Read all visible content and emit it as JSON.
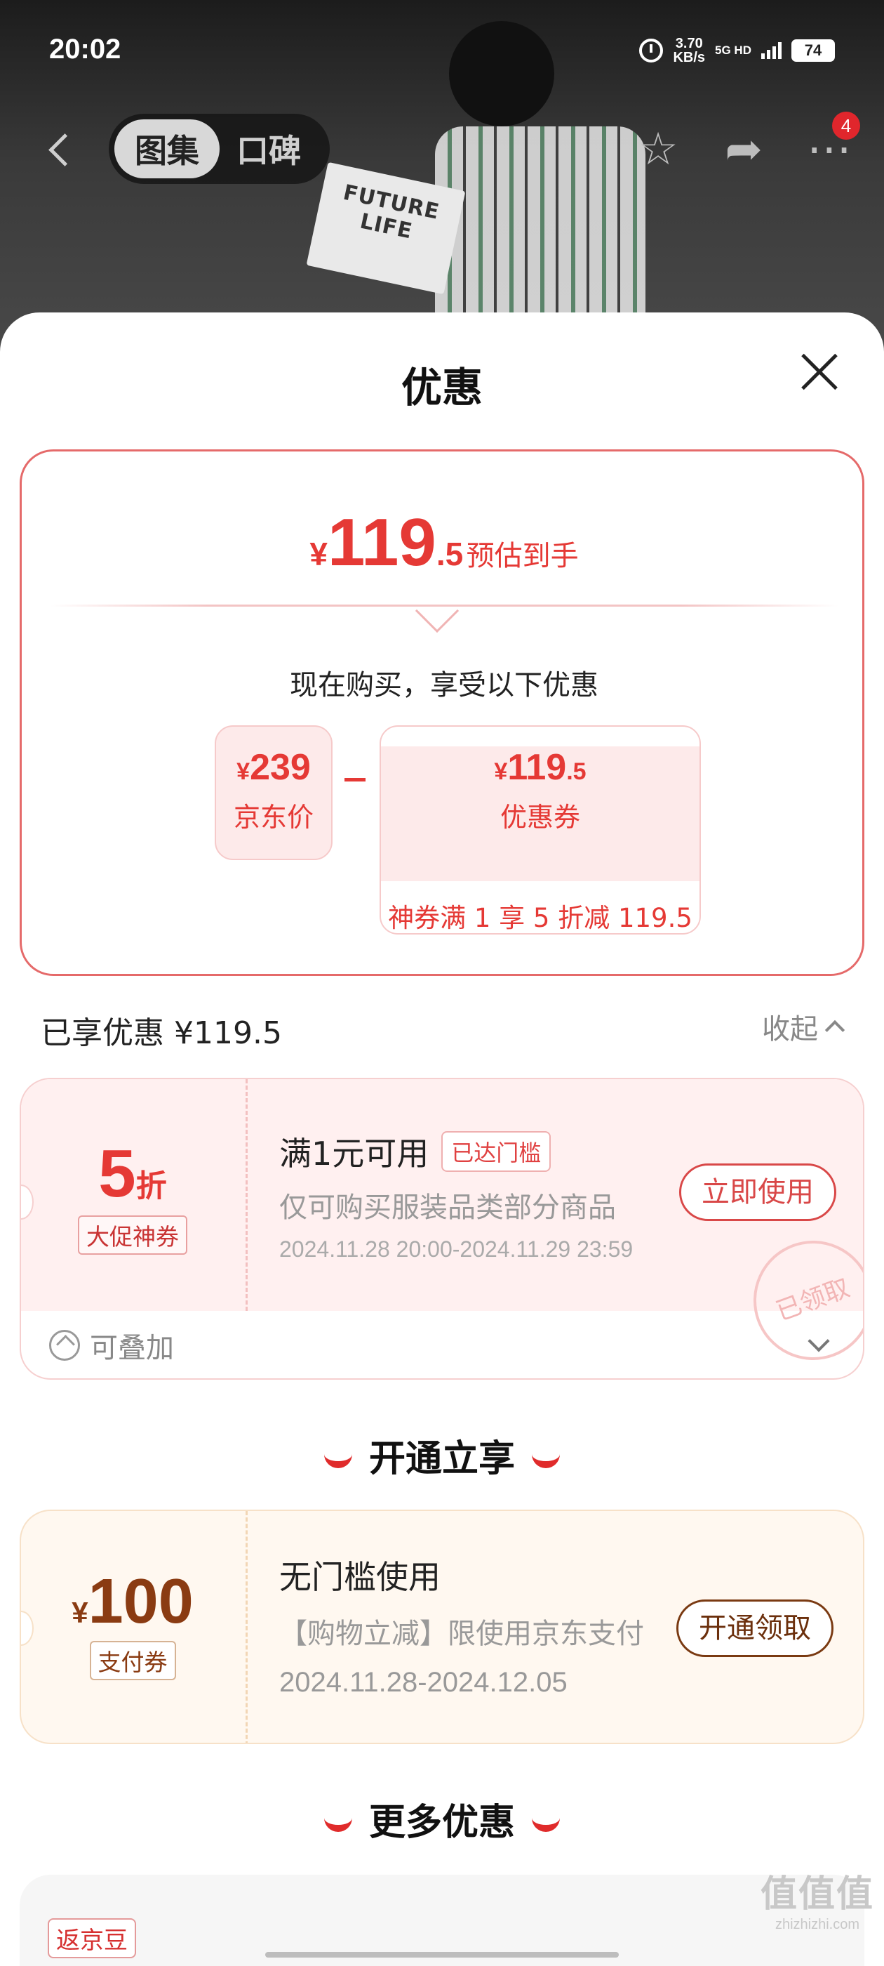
{
  "status_bar": {
    "time": "20:02",
    "net_speed": "3.70",
    "net_unit": "KB/s",
    "net_type": "5G HD",
    "battery": "74"
  },
  "nav": {
    "tabs": [
      {
        "label": "图集",
        "active": true
      },
      {
        "label": "口碑",
        "active": false
      }
    ],
    "more_badge": "4"
  },
  "photo": {
    "magazine_text": "FUTURE LIFE"
  },
  "sheet": {
    "title": "优惠"
  },
  "summary": {
    "currency": "¥",
    "est_int": "119",
    "est_dec": ".5",
    "est_label": "预估到手",
    "subtitle": "现在购买，享受以下优惠",
    "jd_price": {
      "yen": "¥",
      "value": "239",
      "label": "京东价"
    },
    "coupon": {
      "yen": "¥",
      "int": "119",
      "dec": ".5",
      "label": "优惠券",
      "desc": "神券满 1 享 5 折减 119.5"
    }
  },
  "enjoyed": {
    "label": "已享优惠 ¥119.5",
    "collapse_label": "收起"
  },
  "coupon1": {
    "discount": "5",
    "unit": "折",
    "tag": "大促神券",
    "title": "满1元可用",
    "status_tag": "已达门槛",
    "desc": "仅可购买服装品类部分商品",
    "date": "2024.11.28 20:00-2024.11.29 23:59",
    "button": "立即使用",
    "stamp": "已领取",
    "stackable": "可叠加"
  },
  "section_open": {
    "title": "开通立享"
  },
  "coupon2": {
    "yen": "¥",
    "amount": "100",
    "tag": "支付券",
    "title": "无门槛使用",
    "desc": "【购物立减】限使用京东支付",
    "date": "2024.11.28-2024.12.05",
    "button": "开通领取"
  },
  "section_more": {
    "title": "更多优惠"
  },
  "more_card": {
    "tag": "返京豆"
  },
  "watermark": {
    "big": "值值值",
    "small": "zhizhizhi.com"
  },
  "colors": {
    "accent_red": "#e53935",
    "pink_bg": "#fff0f0",
    "brown": "#8a3b12",
    "cream_bg": "#fff8f0"
  }
}
